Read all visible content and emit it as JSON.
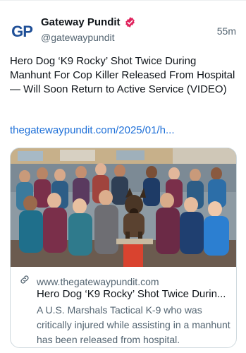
{
  "account": {
    "avatar_text_1": "G",
    "avatar_text_2": "P",
    "name": "Gateway Pundit",
    "handle": "@gatewaypundit",
    "time": "55m",
    "verified_icon": "verified-badge-icon",
    "verified_color": "#e0245e"
  },
  "post": {
    "text": "Hero Dog ‘K9 Rocky’ Shot Twice During Manhunt For Cop Killer Released From Hospital — Will Soon Return to Active Service (VIDEO)",
    "link": "thegatewaypundit.com/2025/01/h..."
  },
  "card": {
    "image": "photo-group-with-k9-dog",
    "domain_icon": "link-icon",
    "domain": "www.thegatewaypundit.com",
    "title": "Hero Dog ‘K9 Rocky’ Shot Twice Durin...",
    "description": "A U.S. Marshals Tactical K-9 who was critically injured while assisting in a manhunt has been released from hospital."
  },
  "colors": {
    "link": "#1d6fd8",
    "muted": "#536471",
    "text": "#0f1419",
    "border": "#cfd9de",
    "brand": "#1f4f97"
  }
}
